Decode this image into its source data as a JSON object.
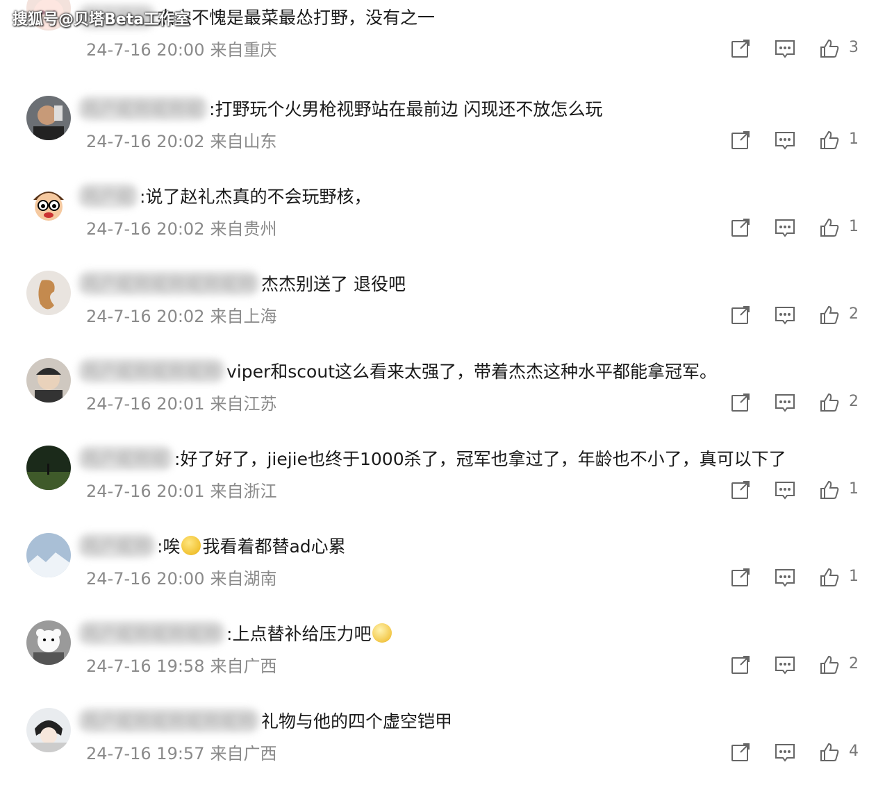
{
  "watermark": "搜狐号@贝塔Beta工作室",
  "comments": [
    {
      "user": "用户昵称",
      "text": "杰杰不愧是最菜最怂打野，没有之一",
      "time": "24-7-16 20:00",
      "location": "来自重庆",
      "likes": "3"
    },
    {
      "user": "用户昵称昵称昵",
      "text": ":打野玩个火男枪视野站在最前边 闪现还不放怎么玩",
      "time": "24-7-16 20:02",
      "location": "来自山东",
      "likes": "1"
    },
    {
      "user": "用户昵",
      "text": ":说了赵礼杰真的不会玩野核，",
      "time": "24-7-16 20:02",
      "location": "来自贵州",
      "likes": "1"
    },
    {
      "user": "用户昵称昵称昵称昵称",
      "text": "杰杰别送了 退役吧",
      "time": "24-7-16 20:02",
      "location": "来自上海",
      "likes": "2"
    },
    {
      "user": "用户昵称昵称昵称",
      "text": "viper和scout这么看来太强了，带着杰杰这种水平都能拿冠军。",
      "time": "24-7-16 20:01",
      "location": "来自江苏",
      "likes": "2"
    },
    {
      "user": "用户昵称昵",
      "text": ":好了好了，jiejie也终于1000杀了，冠军也拿过了，年龄也不小了，真可以下了",
      "time": "24-7-16 20:01",
      "location": "来自浙江",
      "likes": "1"
    },
    {
      "user": "用户昵称",
      "text": ":唉",
      "text_after": "我看着都替ad心累",
      "emoji": true,
      "time": "24-7-16 20:00",
      "location": "来自湖南",
      "likes": "1"
    },
    {
      "user": "用户昵称昵称昵称",
      "text": ":上点替补给压力吧",
      "emoji_end": true,
      "time": "24-7-16 19:58",
      "location": "来自广西",
      "likes": "2"
    },
    {
      "user": "用户昵称昵称昵称昵称",
      "text": "礼物与他的四个虚空铠甲",
      "time": "24-7-16 19:57",
      "location": "来自广西",
      "likes": "4"
    }
  ],
  "icons": {
    "share": "share-icon",
    "reply": "comment-icon",
    "like": "thumbs-up-icon"
  },
  "colors": {
    "meta": "#8a8a8a",
    "text": "#1a1a1a",
    "icon": "#666666"
  }
}
